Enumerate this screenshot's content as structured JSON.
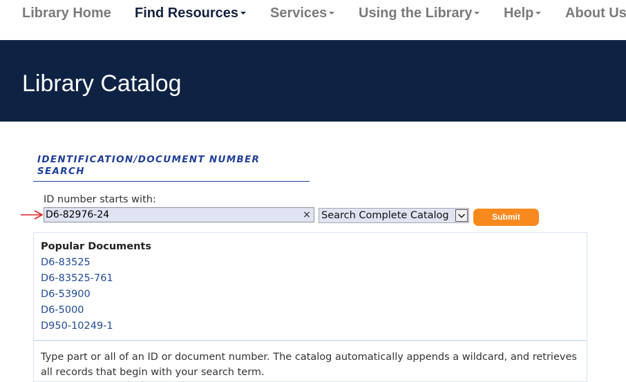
{
  "nav": {
    "items": [
      {
        "label": "Library Home",
        "dropdown": false,
        "active": false
      },
      {
        "label": "Find Resources",
        "dropdown": true,
        "active": true
      },
      {
        "label": "Services",
        "dropdown": true,
        "active": false
      },
      {
        "label": "Using the Library",
        "dropdown": true,
        "active": false
      },
      {
        "label": "Help",
        "dropdown": true,
        "active": false
      },
      {
        "label": "About Us",
        "dropdown": false,
        "active": false
      }
    ]
  },
  "banner": {
    "title": "Library Catalog"
  },
  "search": {
    "heading": "IDENTIFICATION/DOCUMENT NUMBER SEARCH",
    "field_label": "ID number starts with:",
    "input_value": "D6-82976-24",
    "clear_symbol": "×",
    "scope_selected": "Search Complete Catalog",
    "submit_label": "Submit"
  },
  "popular": {
    "title": "Popular Documents",
    "items": [
      "D6-83525",
      "D6-83525-761",
      "D6-53900",
      "D6-5000",
      "D950-10249-1"
    ]
  },
  "help": {
    "text": "Type part or all of an ID or document number. The catalog automatically appends a wildcard, and retrieves all records that begin with your search term."
  },
  "colors": {
    "banner_bg": "#0e2344",
    "heading_blue": "#1f3f99",
    "link_blue": "#1f4a96",
    "submit_orange": "#f8891e",
    "arrow_red": "#e02020"
  },
  "icons": {
    "arrow": "red-arrow-icon",
    "clear": "close-icon",
    "select": "chevron-down-icon",
    "nav_dropdown": "caret-down-icon"
  }
}
